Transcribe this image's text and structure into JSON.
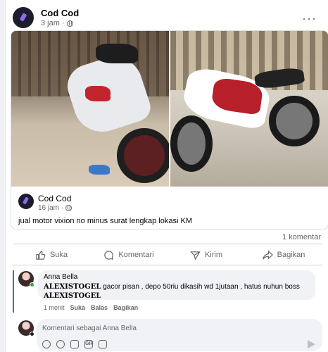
{
  "post": {
    "author": "Cod Cod",
    "time": "3 jam",
    "separator": "·",
    "more_label": "···",
    "shared": {
      "author": "Cod Cod",
      "time": "16 jam",
      "separator": "·",
      "caption": "jual motor vixion no minus surat lengkap lokasi KM"
    }
  },
  "stats": {
    "comment_count": "1 komentar"
  },
  "actions": [
    {
      "label": "Suka",
      "icon": "like-icon"
    },
    {
      "label": "Komentari",
      "icon": "comment-icon"
    },
    {
      "label": "Kirim",
      "icon": "send-icon"
    },
    {
      "label": "Bagikan",
      "icon": "share-icon"
    }
  ],
  "comment": {
    "author": "Anna Bella",
    "brand": "ALEXISTOGEL",
    "text": " gacor pisan , depo 50riu dikasih wd 1jutaan , hatus nuhun boss",
    "brand2": "ALEXISTOGEL",
    "time": "1 menit",
    "like": "Suka",
    "reply": "Balas",
    "share": "Bagikan"
  },
  "composer": {
    "placeholder": "Komentari sebagai Anna Bella",
    "tool_labels": [
      "GIF"
    ]
  },
  "colors": {
    "accent": "#1877f2",
    "muted": "#65676b",
    "online": "#31a24c"
  }
}
